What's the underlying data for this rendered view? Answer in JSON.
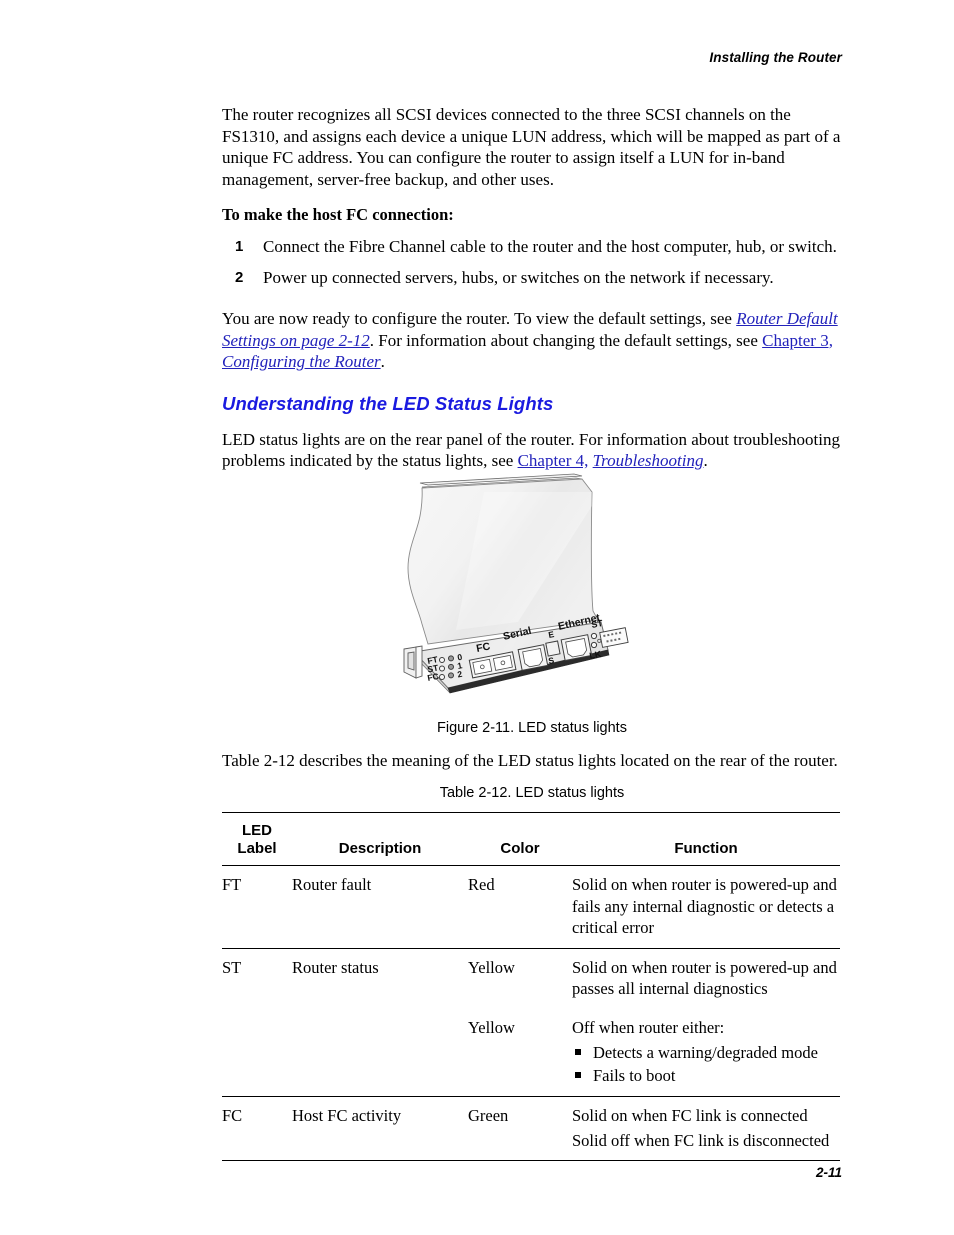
{
  "header": {
    "running_title": "Installing the Router"
  },
  "intro": {
    "paragraph": "The router recognizes all SCSI devices connected to the three SCSI channels on the FS1310, and assigns each device a unique LUN address, which will be mapped as part of a unique FC address. You can configure the router to assign itself a LUN for in-band management, server-free backup, and other uses."
  },
  "procedure": {
    "lead_in": "To make the host FC connection:",
    "steps": [
      {
        "number": "1",
        "text": "Connect the Fibre Channel cable to the router and the host computer, hub, or switch."
      },
      {
        "number": "2",
        "text": "Power up connected servers, hubs, or switches on the network if necessary."
      }
    ]
  },
  "after_steps": {
    "text_1": "You are now ready to configure the router. To view the default settings, see ",
    "link_1": "Router Default Settings on page 2-12",
    "text_2": ". For information about changing the default settings, see ",
    "link_2": "Chapter 3,",
    "link_2b": "Configuring the Router",
    "text_3": "."
  },
  "section": {
    "heading": "Understanding the LED Status Lights",
    "paragraph_1": "LED status lights are on the rear panel of the router. For information about troubleshooting problems indicated by the status lights, see ",
    "link_chapter4": "Chapter 4,",
    "link_troubleshooting": "Troubleshooting",
    "paragraph_end": "."
  },
  "figure": {
    "caption": "Figure 2-11. LED status lights",
    "panel_labels": {
      "led_rows": [
        {
          "name": "FT",
          "number": "0"
        },
        {
          "name": "ST",
          "number": "1"
        },
        {
          "name": "FC",
          "number": "2"
        }
      ],
      "fc_port": "FC",
      "serial_port": "Serial",
      "ethernet_port": "Ethernet",
      "toggle_top": "E",
      "toggle_bottom": "S",
      "eth_led_top": "ST",
      "eth_led_bottom": "LK"
    },
    "colors": {
      "body_light": "#f4f4f4",
      "body_shade": "#e4e4e4",
      "panel_face": "#ededed",
      "outline": "#4a4a4a"
    }
  },
  "table_intro": "Table 2-12 describes the meaning of the LED status lights located on the rear of the router.",
  "table": {
    "caption": "Table 2-12. LED status lights",
    "columns": [
      "LED\nLabel",
      "Description",
      "Color",
      "Function"
    ],
    "column_label_line1": "LED",
    "column_label_line2": "Label",
    "column_description": "Description",
    "column_color": "Color",
    "column_function": "Function",
    "rows": [
      {
        "label": "FT",
        "description": "Router fault",
        "color": "Red",
        "function_lines": [
          "Solid on when router is powered-up and fails any internal diagnostic or detects a critical error"
        ],
        "bullets": []
      },
      {
        "label": "ST",
        "description": "Router status",
        "color": "Yellow",
        "function_lines": [
          "Solid on when router is powered-up and passes all internal diagnostics"
        ],
        "bullets": []
      },
      {
        "label": "",
        "description": "",
        "color": "Yellow",
        "function_lines": [
          "Off when router either:"
        ],
        "bullets": [
          "Detects a warning/degraded mode",
          "Fails to boot"
        ]
      },
      {
        "label": "FC",
        "description": "Host FC activity",
        "color": "Green",
        "function_lines": [
          "Solid on when FC link is connected",
          "Solid off when FC link is disconnected"
        ],
        "bullets": []
      }
    ]
  },
  "footer": {
    "page_number": "2-11"
  },
  "colors": {
    "link_blue": "#2222bb",
    "heading_blue": "#1a1ae0",
    "rule_black": "#000000"
  }
}
